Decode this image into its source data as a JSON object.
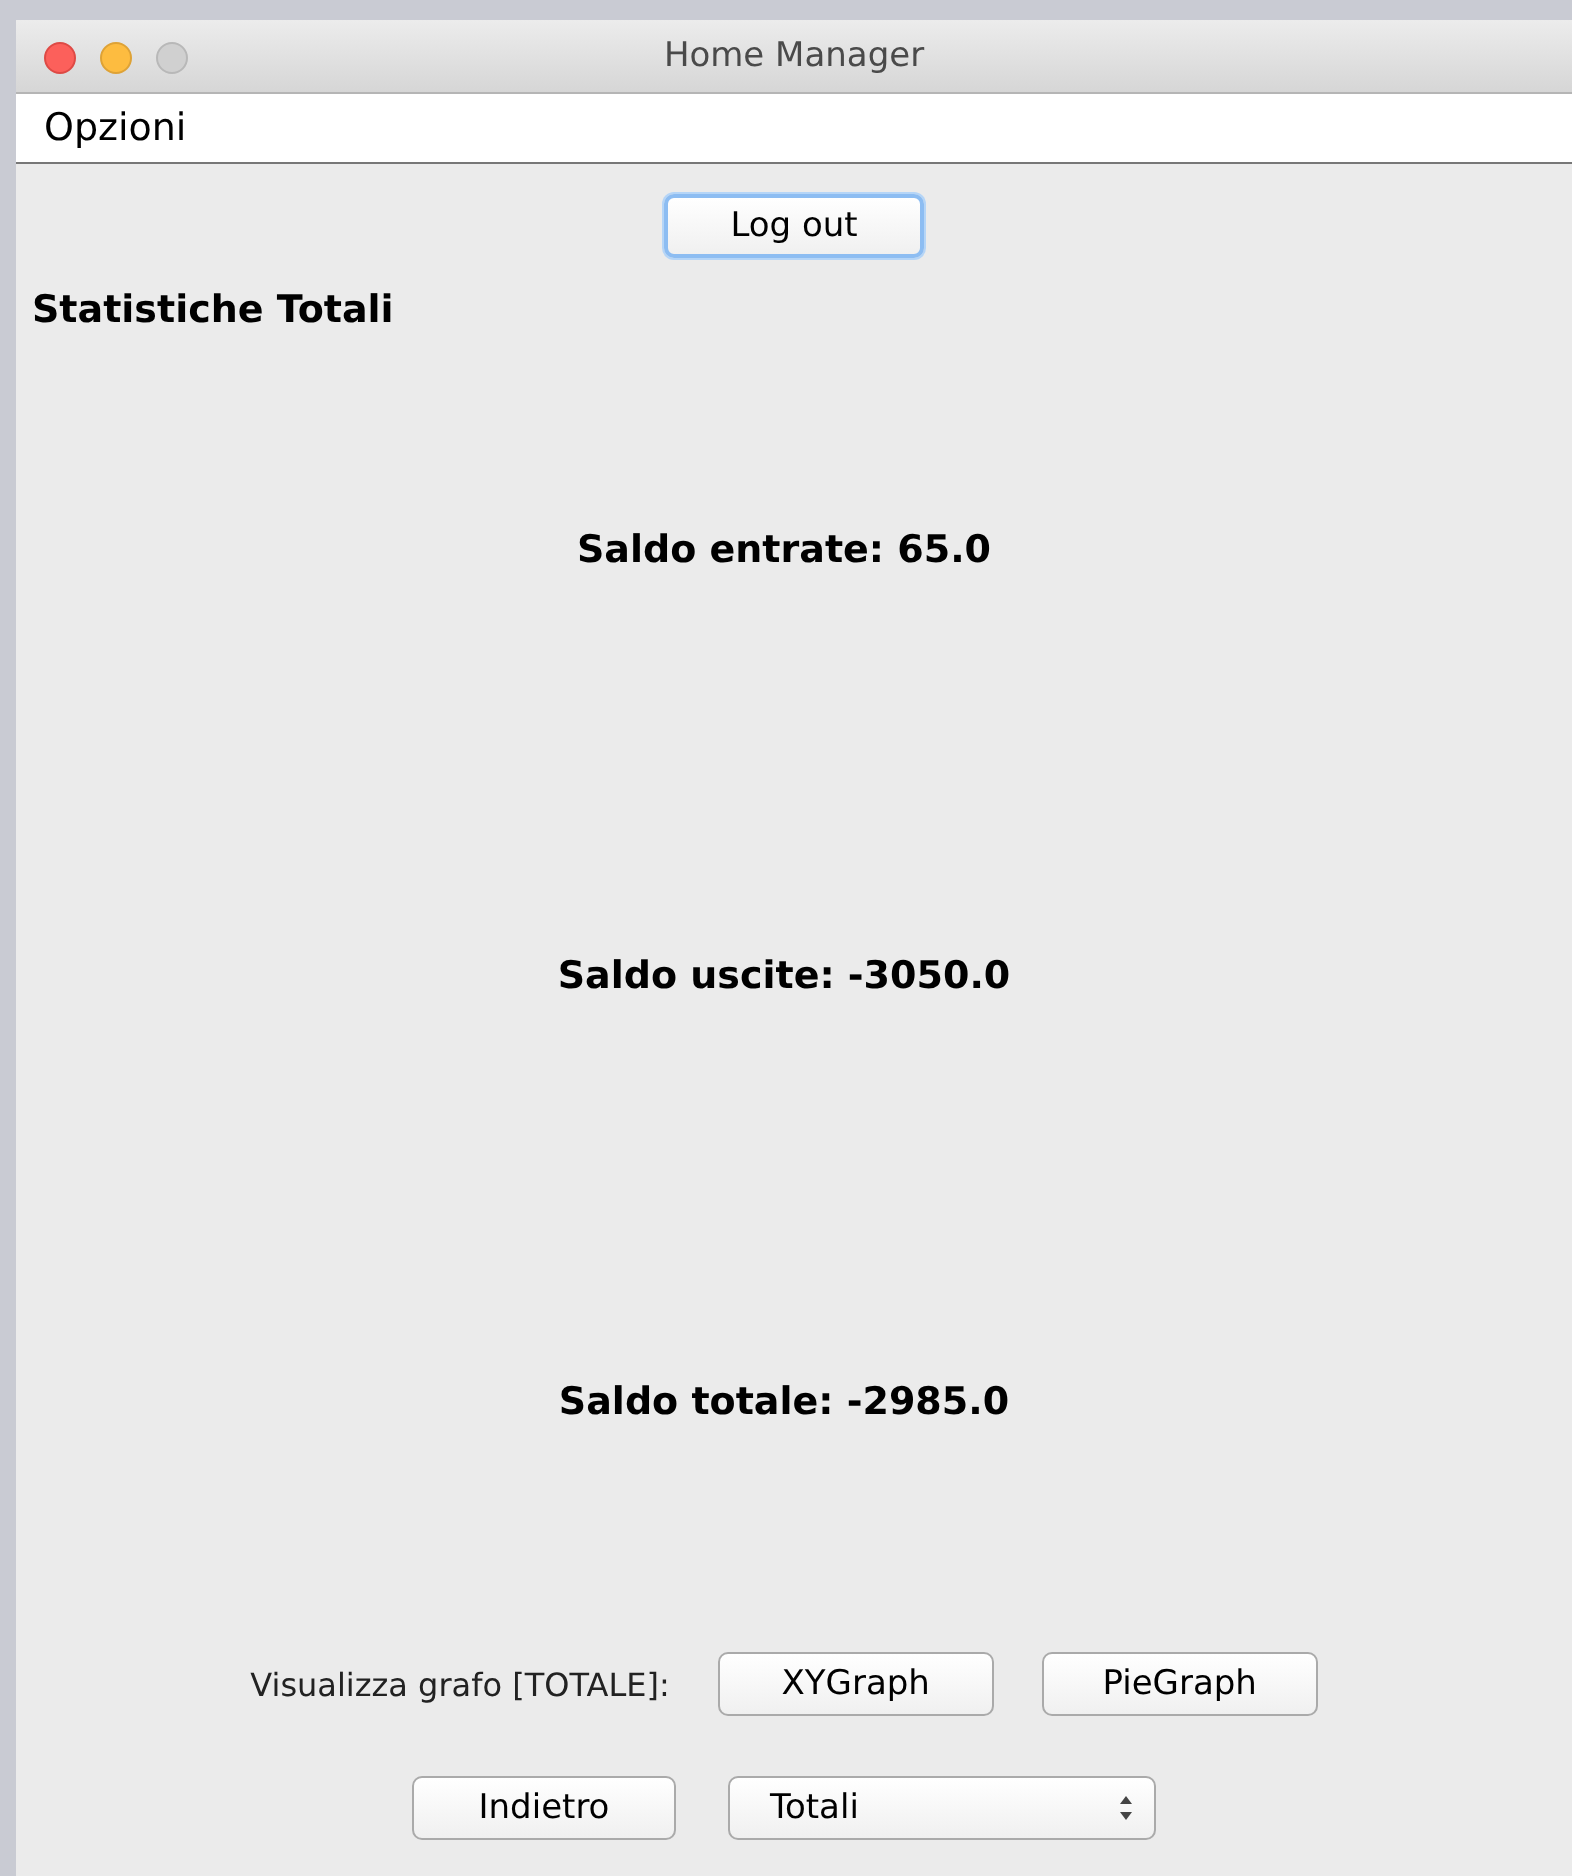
{
  "window": {
    "title": "Home Manager"
  },
  "menu_bar": {
    "items": [
      "Opzioni"
    ]
  },
  "logout_button": {
    "label": "Log out",
    "focused": true
  },
  "heading": "Statistiche Totali",
  "stats": [
    "Saldo entrate: 65.0",
    "Saldo uscite: -3050.0",
    "Saldo totale: -2985.0"
  ],
  "graph_row": {
    "label": "Visualizza grafo [TOTALE]:",
    "buttons": [
      "XYGraph",
      "PieGraph"
    ]
  },
  "back_button": {
    "label": "Indietro"
  },
  "period_select": {
    "value": "Totali"
  }
}
